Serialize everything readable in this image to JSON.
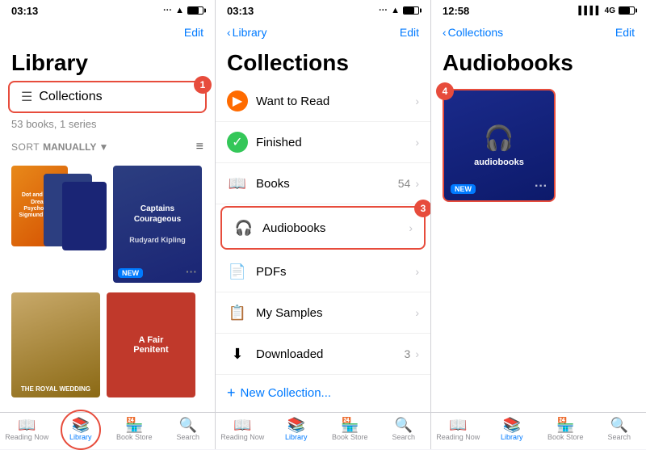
{
  "panel1": {
    "status": {
      "time": "03:13",
      "dots": "...",
      "wifi": "wifi",
      "battery": "battery"
    },
    "nav": {
      "edit_label": "Edit"
    },
    "title": "Library",
    "collections_label": "Collections",
    "book_count": "53 books, 1 series",
    "sort": {
      "label": "SORT",
      "value": "MANUALLY ▼"
    },
    "books": [
      {
        "title": "Dot and the ...\nDream Psychology\nSigmund Freud",
        "color": "#e8891a"
      },
      {
        "title": "Captains\nCourageous\n\nRudyard Kipling",
        "color": "#2c3e80"
      }
    ],
    "books2": [
      {
        "title": "THE ROYAL WEDDING",
        "color": "#c8a96a"
      },
      {
        "title": "A Fair\nPenitent",
        "color": "#c0392b"
      }
    ],
    "tab_bar": [
      {
        "icon": "📖",
        "label": "Reading Now",
        "active": false
      },
      {
        "icon": "📚",
        "label": "Library",
        "active": true,
        "circled": true
      },
      {
        "icon": "🏪",
        "label": "Book Store",
        "active": false
      },
      {
        "icon": "🔍",
        "label": "Search",
        "active": false
      }
    ],
    "badge1": "1"
  },
  "panel2": {
    "status": {
      "time": "03:13",
      "dots": "...",
      "wifi": "wifi",
      "battery": "battery"
    },
    "nav": {
      "back_label": "Library",
      "edit_label": "Edit"
    },
    "title": "Collections",
    "items": [
      {
        "icon_type": "circle_orange",
        "icon": "▶",
        "name": "Want to Read",
        "count": "",
        "highlighted": false
      },
      {
        "icon_type": "circle_green",
        "icon": "✓",
        "name": "Finished",
        "count": "",
        "highlighted": false
      },
      {
        "icon_type": "book",
        "icon": "📖",
        "name": "Books",
        "count": "54",
        "highlighted": false
      },
      {
        "icon_type": "headphone",
        "icon": "🎧",
        "name": "Audiobooks",
        "count": "",
        "highlighted": true
      },
      {
        "icon_type": "doc",
        "icon": "📄",
        "name": "PDFs",
        "count": "",
        "highlighted": false
      },
      {
        "icon_type": "sample",
        "icon": "📋",
        "name": "My Samples",
        "count": "",
        "highlighted": false
      },
      {
        "icon_type": "download",
        "icon": "⬇",
        "name": "Downloaded",
        "count": "3",
        "highlighted": false
      }
    ],
    "new_collection": "New Collection...",
    "tab_bar": [
      {
        "icon": "📖",
        "label": "Reading Now",
        "active": false
      },
      {
        "icon": "📚",
        "label": "Library",
        "active": true
      },
      {
        "icon": "🏪",
        "label": "Book Store",
        "active": false
      },
      {
        "icon": "🔍",
        "label": "Search",
        "active": false
      }
    ],
    "badge3": "3"
  },
  "panel3": {
    "status": {
      "time": "12:58",
      "signal": "▌▌▌▌",
      "signal_4g": "4G",
      "battery": "battery"
    },
    "nav": {
      "back_label": "Collections",
      "edit_label": "Edit"
    },
    "title": "Audiobooks",
    "audiobook": {
      "label": "audiobooks",
      "new_label": "NEW"
    },
    "tab_bar": [
      {
        "icon": "📖",
        "label": "Reading Now",
        "active": false
      },
      {
        "icon": "📚",
        "label": "Library",
        "active": true
      },
      {
        "icon": "🏪",
        "label": "Book Store",
        "active": false
      },
      {
        "icon": "🔍",
        "label": "Search",
        "active": false
      }
    ],
    "badge4": "4"
  }
}
